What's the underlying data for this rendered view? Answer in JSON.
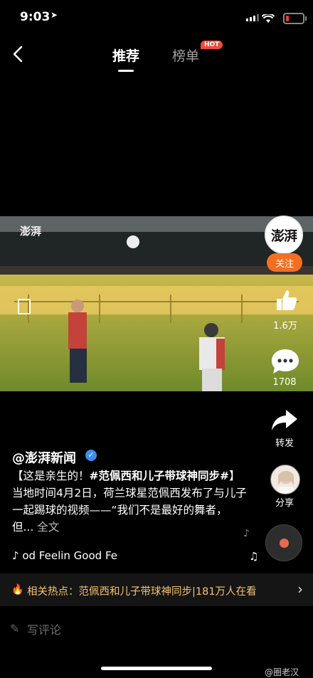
{
  "status": {
    "time": "9:03"
  },
  "nav": {
    "tab_active": "推荐",
    "tab_inactive": "榜单",
    "hot_badge": "HOT"
  },
  "video": {
    "logo_text": "澎湃"
  },
  "rail": {
    "avatar_text": "澎湃",
    "follow": "关注",
    "likes": "1.6万",
    "comments": "1708",
    "share": "转发",
    "share_user": "分享"
  },
  "post": {
    "author": "@澎湃新闻",
    "caption_lead": "【这是亲生的！",
    "caption_hashtag": "#范佩西和儿子带球神同步#",
    "caption_rest": "】当地时间4月2日，荷兰球星范佩西发布了与儿子一起踢球的视频——“我们不是最好的舞者，但...",
    "more": "全文",
    "music": "♪ od  Feelin Good  Fe"
  },
  "hotbar": {
    "text": "相关热点：范佩西和儿子带球神同步|181万人在看"
  },
  "comment": {
    "placeholder": "写评论"
  },
  "watermark": "@圈老汉",
  "colors": {
    "accent_orange": "#f36f20",
    "hot_text": "#f4c36b",
    "hot_badge": "#f04b3a",
    "verified": "#3d8cf0"
  }
}
